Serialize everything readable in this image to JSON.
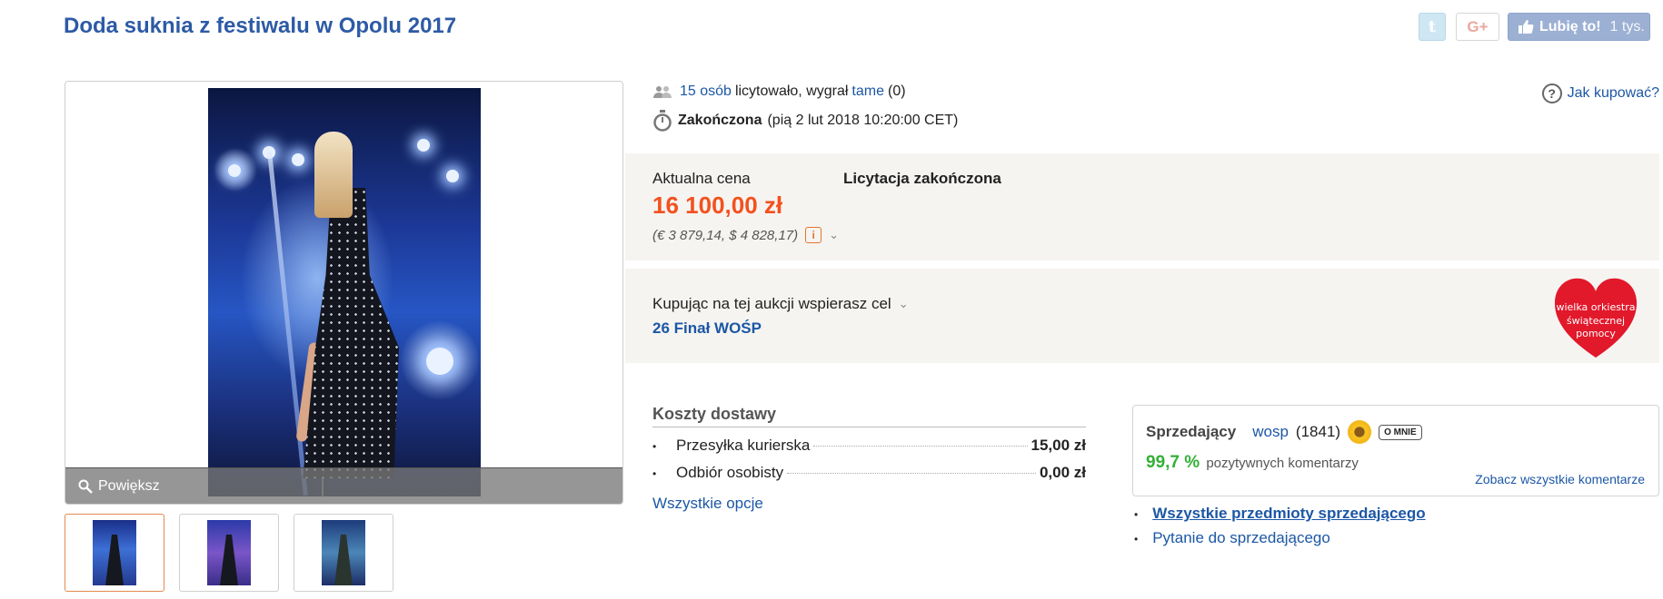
{
  "title": "Doda suknia z festiwalu w Opolu 2017",
  "social": {
    "twitter_glyph": "t",
    "gplus_label": "G+",
    "like_label": "Lubię to!",
    "like_count": "1 tys."
  },
  "gallery": {
    "zoom_label": "Powiększ",
    "thumbnails": [
      "thumb-1",
      "thumb-2",
      "thumb-3"
    ]
  },
  "bidding": {
    "bidders_link": "15 osób",
    "bidders_text": "licytowało, wygrał",
    "winner": "tame",
    "winner_score": "(0)"
  },
  "status": {
    "label": "Zakończona",
    "date": "(pią 2 lut 2018 10:20:00 CET)"
  },
  "help": {
    "label": "Jak kupować?"
  },
  "price": {
    "label": "Aktualna cena",
    "status": "Licytacja zakończona",
    "value": "16 100,00 zł",
    "conversion": "(€ 3 879,14, $ 4 828,17)",
    "accent": "#f3511e"
  },
  "charity": {
    "label": "Kupując na tej aukcji wspierasz cel",
    "goal": "26 Finał WOŚP",
    "logo_line1": "wielka orkiestra",
    "logo_line2": "świątecznej",
    "logo_line3": "pomocy"
  },
  "shipping": {
    "header": "Koszty dostawy",
    "rows": [
      {
        "name": "Przesyłka kurierska",
        "price": "15,00 zł"
      },
      {
        "name": "Odbiór osobisty",
        "price": "0,00 zł"
      }
    ],
    "all_options": "Wszystkie opcje"
  },
  "seller": {
    "label": "Sprzedający",
    "name": "wosp",
    "rating_count": "(1841)",
    "about_badge": "O MNIE",
    "positive_pct": "99,7 %",
    "positive_text": "pozytywnych komentarzy",
    "all_comments": "Zobacz wszystkie komentarze",
    "links": [
      "Wszystkie przedmioty sprzedającego",
      "Pytanie do sprzedającego"
    ]
  },
  "colors": {
    "link": "#1c57a5",
    "title": "#2d5aa6",
    "positive": "#33b035",
    "box_bg": "#f5f4f1"
  }
}
